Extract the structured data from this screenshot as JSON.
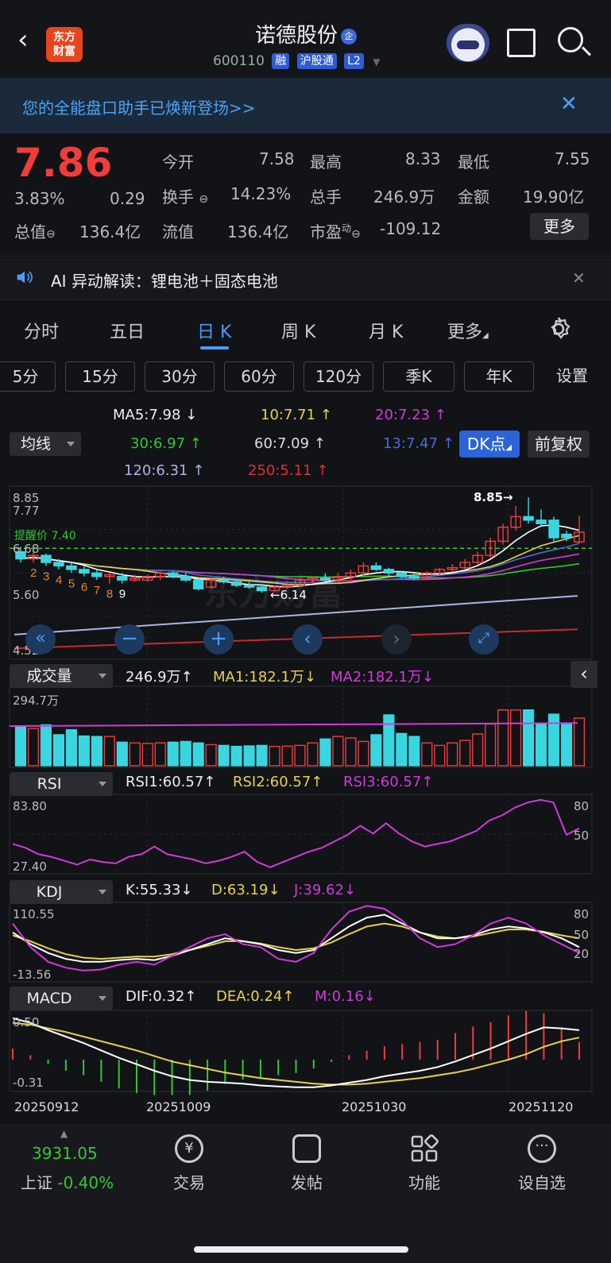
{
  "header": {
    "back_icon": "chevron-left-icon",
    "logo_text_1": "东方",
    "logo_text_2": "财富",
    "title": "诺德股份",
    "title_badge": "企",
    "code": "600110",
    "tags": [
      "融",
      "沪股通",
      "L2"
    ]
  },
  "banner": {
    "text": "您的全能盘口助手已焕新登场>>",
    "close": "✕"
  },
  "quote": {
    "price": "7.86",
    "change_pct": "3.83%",
    "change": "0.29",
    "open_label": "今开",
    "open": "7.58",
    "high_label": "最高",
    "high": "8.33",
    "low_label": "最低",
    "low": "7.55",
    "turnover_label": "换手",
    "turnover": "14.23%",
    "vol_label": "总手",
    "vol": "246.9万",
    "amount_label": "金额",
    "amount": "19.90亿",
    "mcap_label": "总值",
    "mcap": "136.4亿",
    "float_label": "流值",
    "float": "136.4亿",
    "pe_label": "市盈",
    "pe_sup": "动",
    "pe": "-109.12",
    "more": "更多"
  },
  "ai": {
    "text": "AI 异动解读：锂电池＋固态电池",
    "close": "✕"
  },
  "tabs": [
    "分时",
    "五日",
    "日 K",
    "周 K",
    "月 K",
    "更多"
  ],
  "active_tab": 2,
  "periods": [
    "5分",
    "15分",
    "30分",
    "60分",
    "120分",
    "季K",
    "年K",
    "设置"
  ],
  "ma_selector": "均线",
  "ma": {
    "ma5": "MA5:7.98",
    "ma10": "10:7.71",
    "ma20": "20:7.23",
    "ma30": "30:6.97",
    "ma60": "60:7.09",
    "ma13": "13:7.47",
    "ma120": "120:6.31",
    "ma250": "250:5.11"
  },
  "dk_btn": "DK点",
  "fq_btn": "前复权",
  "price_axis": [
    "8.85",
    "7.77",
    "6.68",
    "5.60",
    "4.52"
  ],
  "annotations": {
    "high": "8.85→",
    "low": "←6.14",
    "watermark": "东方财富",
    "line_label": "提醒价 7.40"
  },
  "vol_panel": {
    "selector": "成交量",
    "value": "246.9万",
    "ma1": "MA1:182.1万",
    "ma2": "MA2:182.1万",
    "axis_top": "294.7万"
  },
  "rsi_panel": {
    "selector": "RSI",
    "rsi1": "RSI1:60.57",
    "rsi2": "RSI2:60.57",
    "rsi3": "RSI3:60.57",
    "axis_top": "83.80",
    "axis_bottom": "27.40",
    "right_80": "80",
    "right_50": "50"
  },
  "kdj_panel": {
    "selector": "KDJ",
    "k": "K:55.33",
    "d": "D:63.19",
    "j": "J:39.62",
    "axis_top": "110.55",
    "axis_bottom": "-13.56",
    "right": [
      "80",
      "50",
      "20"
    ]
  },
  "macd_panel": {
    "selector": "MACD",
    "dif": "DIF:0.32",
    "dea": "DEA:0.24",
    "m": "M:0.16",
    "axis_top": "0.50",
    "axis_bottom": "-0.31"
  },
  "dates": [
    "20250912",
    "20251009",
    "20251030",
    "20251120"
  ],
  "footer": {
    "index_value": "3931.05",
    "index_name": "上证",
    "index_change": "-0.40%",
    "items": [
      "交易",
      "发帖",
      "功能",
      "设自选"
    ]
  },
  "colors": {
    "up": "#f23c3c",
    "down": "#3ad6e0",
    "ma5": "#ffffff",
    "ma10": "#e8d24a",
    "ma20": "#d23ad8",
    "accent": "#4a9cf5"
  },
  "chart_data": {
    "type": "candlestick",
    "ylim": [
      4.52,
      8.85
    ],
    "candles": [
      {
        "o": 7.3,
        "c": 7.1,
        "h": 7.45,
        "l": 7.0
      },
      {
        "o": 7.1,
        "c": 7.2,
        "h": 7.3,
        "l": 7.0
      },
      {
        "o": 7.2,
        "c": 7.0,
        "h": 7.25,
        "l": 6.9
      },
      {
        "o": 7.0,
        "c": 6.9,
        "h": 7.1,
        "l": 6.8
      },
      {
        "o": 6.9,
        "c": 6.8,
        "h": 7.0,
        "l": 6.7
      },
      {
        "o": 6.8,
        "c": 6.7,
        "h": 6.9,
        "l": 6.6
      },
      {
        "o": 6.7,
        "c": 6.6,
        "h": 6.8,
        "l": 6.5
      },
      {
        "o": 6.6,
        "c": 6.65,
        "h": 6.7,
        "l": 6.4
      },
      {
        "o": 6.6,
        "c": 6.5,
        "h": 6.7,
        "l": 6.4
      },
      {
        "o": 6.5,
        "c": 6.55,
        "h": 6.65,
        "l": 6.45
      },
      {
        "o": 6.5,
        "c": 6.6,
        "h": 6.65,
        "l": 6.45
      },
      {
        "o": 6.6,
        "c": 6.7,
        "h": 6.75,
        "l": 6.5
      },
      {
        "o": 6.7,
        "c": 6.6,
        "h": 6.75,
        "l": 6.55
      },
      {
        "o": 6.6,
        "c": 6.5,
        "h": 6.7,
        "l": 6.45
      },
      {
        "o": 6.5,
        "c": 6.25,
        "h": 6.55,
        "l": 6.2
      },
      {
        "o": 6.3,
        "c": 6.5,
        "h": 6.55,
        "l": 6.25
      },
      {
        "o": 6.5,
        "c": 6.45,
        "h": 6.6,
        "l": 6.4
      },
      {
        "o": 6.45,
        "c": 6.35,
        "h": 6.5,
        "l": 6.3
      },
      {
        "o": 6.35,
        "c": 6.3,
        "h": 6.45,
        "l": 6.25
      },
      {
        "o": 6.3,
        "c": 6.2,
        "h": 6.35,
        "l": 6.14
      },
      {
        "o": 6.2,
        "c": 6.3,
        "h": 6.35,
        "l": 6.15
      },
      {
        "o": 6.3,
        "c": 6.35,
        "h": 6.45,
        "l": 6.25
      },
      {
        "o": 6.35,
        "c": 6.5,
        "h": 6.55,
        "l": 6.3
      },
      {
        "o": 6.5,
        "c": 6.55,
        "h": 6.6,
        "l": 6.4
      },
      {
        "o": 6.55,
        "c": 6.5,
        "h": 6.7,
        "l": 6.45
      },
      {
        "o": 6.5,
        "c": 6.6,
        "h": 6.7,
        "l": 6.45
      },
      {
        "o": 6.6,
        "c": 6.7,
        "h": 6.8,
        "l": 6.5
      },
      {
        "o": 6.7,
        "c": 6.9,
        "h": 7.0,
        "l": 6.6
      },
      {
        "o": 6.9,
        "c": 6.8,
        "h": 7.0,
        "l": 6.75
      },
      {
        "o": 6.8,
        "c": 6.7,
        "h": 6.85,
        "l": 6.6
      },
      {
        "o": 6.7,
        "c": 6.6,
        "h": 6.75,
        "l": 6.55
      },
      {
        "o": 6.6,
        "c": 6.55,
        "h": 6.7,
        "l": 6.5
      },
      {
        "o": 6.55,
        "c": 6.7,
        "h": 6.75,
        "l": 6.5
      },
      {
        "o": 6.7,
        "c": 6.8,
        "h": 6.85,
        "l": 6.65
      },
      {
        "o": 6.8,
        "c": 6.85,
        "h": 6.95,
        "l": 6.75
      },
      {
        "o": 6.85,
        "c": 7.0,
        "h": 7.1,
        "l": 6.8
      },
      {
        "o": 7.0,
        "c": 7.2,
        "h": 7.3,
        "l": 6.95
      },
      {
        "o": 7.2,
        "c": 7.6,
        "h": 7.7,
        "l": 7.1
      },
      {
        "o": 7.6,
        "c": 8.0,
        "h": 8.1,
        "l": 7.5
      },
      {
        "o": 8.0,
        "c": 8.3,
        "h": 8.6,
        "l": 7.9
      },
      {
        "o": 8.3,
        "c": 8.2,
        "h": 8.85,
        "l": 8.1
      },
      {
        "o": 8.2,
        "c": 8.1,
        "h": 8.5,
        "l": 8.0
      },
      {
        "o": 8.2,
        "c": 7.7,
        "h": 8.3,
        "l": 7.6
      },
      {
        "o": 7.8,
        "c": 7.7,
        "h": 7.9,
        "l": 7.6
      },
      {
        "o": 7.58,
        "c": 7.86,
        "h": 8.33,
        "l": 7.55
      }
    ],
    "volume": [
      160,
      150,
      165,
      125,
      145,
      120,
      118,
      118,
      95,
      92,
      90,
      92,
      95,
      98,
      92,
      85,
      82,
      78,
      80,
      82,
      78,
      79,
      82,
      92,
      108,
      118,
      112,
      98,
      125,
      205,
      130,
      118,
      92,
      82,
      92,
      102,
      128,
      168,
      225,
      225,
      225,
      172,
      208,
      172,
      192
    ],
    "volume_max": 294.7,
    "rsi": [
      48,
      45,
      40,
      38,
      35,
      32,
      36,
      34,
      33,
      38,
      40,
      46,
      40,
      38,
      36,
      33,
      35,
      38,
      42,
      34,
      30,
      34,
      38,
      42,
      45,
      50,
      55,
      62,
      56,
      64,
      56,
      50,
      46,
      48,
      50,
      54,
      58,
      66,
      70,
      76,
      80,
      82,
      80,
      55,
      60
    ],
    "rsi_range": [
      27.4,
      83.8
    ],
    "k": [
      65,
      45,
      30,
      20,
      15,
      15,
      18,
      20,
      18,
      25,
      35,
      45,
      55,
      50,
      45,
      35,
      30,
      35,
      55,
      75,
      90,
      95,
      80,
      65,
      55,
      55,
      60,
      70,
      75,
      72,
      65,
      55,
      40
    ],
    "d": [
      60,
      50,
      38,
      28,
      22,
      20,
      22,
      24,
      24,
      28,
      35,
      42,
      50,
      50,
      46,
      40,
      35,
      38,
      48,
      62,
      75,
      80,
      75,
      65,
      58,
      55,
      58,
      64,
      70,
      70,
      66,
      60,
      55
    ],
    "j": [
      80,
      40,
      15,
      5,
      0,
      2,
      10,
      15,
      10,
      25,
      40,
      55,
      62,
      45,
      40,
      20,
      15,
      30,
      70,
      100,
      110,
      105,
      85,
      55,
      40,
      45,
      60,
      80,
      90,
      80,
      60,
      45,
      30
    ],
    "kdj_range": [
      -13.56,
      110.55
    ],
    "dif": [
      0.45,
      0.4,
      0.32,
      0.25,
      0.18,
      0.1,
      0.02,
      -0.05,
      -0.12,
      -0.18,
      -0.22,
      -0.24,
      -0.25,
      -0.26,
      -0.28,
      -0.29,
      -0.3,
      -0.3,
      -0.28,
      -0.25,
      -0.22,
      -0.18,
      -0.15,
      -0.12,
      -0.08,
      -0.02,
      0.05,
      0.12,
      0.2,
      0.28,
      0.35,
      0.34,
      0.32
    ],
    "dea": [
      0.4,
      0.38,
      0.34,
      0.3,
      0.25,
      0.2,
      0.15,
      0.1,
      0.04,
      -0.02,
      -0.06,
      -0.1,
      -0.14,
      -0.17,
      -0.2,
      -0.22,
      -0.24,
      -0.26,
      -0.27,
      -0.27,
      -0.26,
      -0.24,
      -0.22,
      -0.2,
      -0.17,
      -0.14,
      -0.1,
      -0.05,
      0.0,
      0.06,
      0.14,
      0.2,
      0.24
    ],
    "macd_range": [
      -0.31,
      0.5
    ],
    "x_dates": [
      "20250912",
      "20251009",
      "20251030",
      "20251120"
    ]
  }
}
